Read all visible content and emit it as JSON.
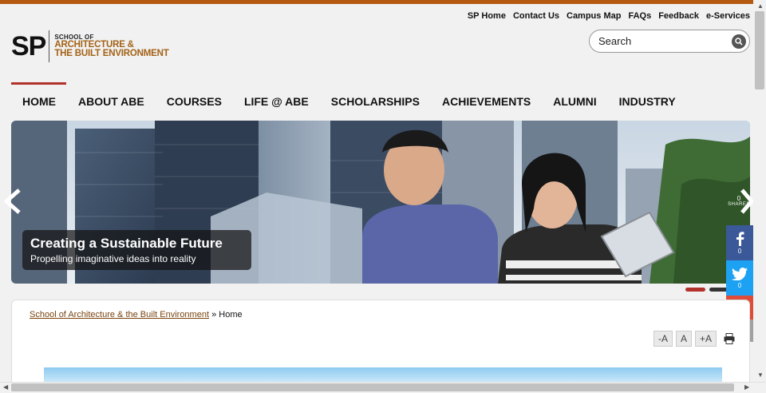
{
  "utility_links": [
    "SP Home",
    "Contact Us",
    "Campus Map",
    "FAQs",
    "Feedback",
    "e-Services"
  ],
  "logo": {
    "mark": "SP",
    "line1": "SCHOOL OF",
    "line2": "ARCHITECTURE &",
    "line3": "THE BUILT ENVIRONMENT"
  },
  "search": {
    "placeholder": "Search"
  },
  "nav": [
    "HOME",
    "ABOUT ABE",
    "COURSES",
    "LIFE @ ABE",
    "SCHOLARSHIPS",
    "ACHIEVEMENTS",
    "ALUMNI",
    "INDUSTRY"
  ],
  "hero": {
    "title": "Creating a Sustainable Future",
    "subtitle": "Propelling imaginative ideas into reality"
  },
  "share": {
    "total": "0",
    "total_label": "SHARES",
    "facebook_count": "0",
    "twitter_count": "0"
  },
  "breadcrumb": {
    "link": "School of Architecture & the Built Environment",
    "separator": "»",
    "current": "Home"
  },
  "font_size_buttons": [
    "-A",
    "A",
    "+A"
  ],
  "colors": {
    "accent_brown": "#b45a12",
    "nav_active": "#b3312b",
    "facebook": "#3b5998",
    "twitter": "#1da1f2",
    "gmail": "#dd4b39",
    "more": "#a0a0a0"
  }
}
